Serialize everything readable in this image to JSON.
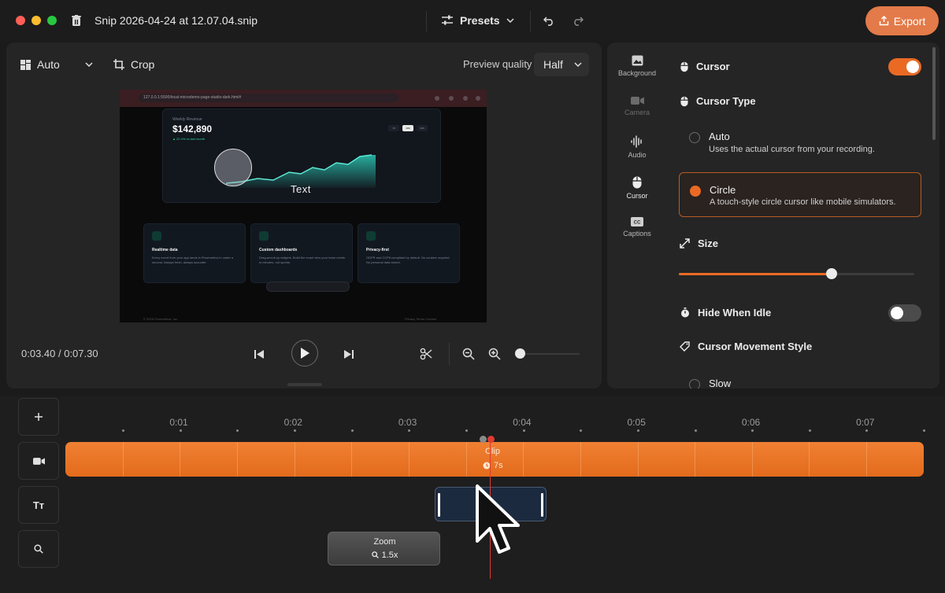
{
  "window": {
    "title": "Snip 2026-04-24 at 12.07.04.snip",
    "presets_label": "Presets",
    "export_label": "Export"
  },
  "preview": {
    "layout_label": "Auto",
    "crop_label": "Crop",
    "quality_label": "Preview quality",
    "quality_value": "Half",
    "timecode": "0:03.40 / 0:07.30",
    "zoom_level": 0.05,
    "video": {
      "url": "127.0.0.1:5500/local-microdemo-page-studio-dark.html#",
      "hero_caption": "Weekly Revenue",
      "hero_value": "$142,890",
      "hero_change": "▲ 22.4% vs last month",
      "pills": [
        "7D",
        "30D",
        "90D"
      ],
      "overlay_text": "Text",
      "features": [
        {
          "title": "Realtime data",
          "desc": "Every event from your app lands in Flowmetrics in under a second. Always fresh, always accurate."
        },
        {
          "title": "Custom dashboards",
          "desc": "Drag-and-drop widgets. Build the exact view your team needs in minutes, not sprints."
        },
        {
          "title": "Privacy-first",
          "desc": "GDPR and CCPA compliant by default. No cookies required. No personal data stored."
        }
      ],
      "footer_left": "© 2026 Flowmetrics, Inc.",
      "footer_right": "Privacy   Terms   Contact"
    }
  },
  "inspector": {
    "tabs": [
      {
        "label": "Background",
        "icon": "image-icon"
      },
      {
        "label": "Camera",
        "icon": "camera-icon"
      },
      {
        "label": "Audio",
        "icon": "waveform-icon"
      },
      {
        "label": "Cursor",
        "icon": "mouse-icon"
      },
      {
        "label": "Captions",
        "icon": "captions-icon"
      }
    ],
    "cursor_label": "Cursor",
    "cursor_enabled": true,
    "cursor_type_label": "Cursor Type",
    "options": [
      {
        "title": "Auto",
        "desc": "Uses the actual cursor from your recording."
      },
      {
        "title": "Circle",
        "desc": "A touch-style circle cursor like mobile simulators."
      }
    ],
    "selected_option": "Circle",
    "size_label": "Size",
    "size_value": 0.65,
    "hide_idle_label": "Hide When Idle",
    "hide_idle_enabled": false,
    "movement_label": "Cursor Movement Style",
    "movement_first_option": "Slow"
  },
  "timeline": {
    "ruler": [
      "0:01",
      "0:02",
      "0:03",
      "0:04",
      "0:05",
      "0:06",
      "0:07"
    ],
    "clip_label": "Clip",
    "clip_duration": "7s",
    "zoom_label": "Zoom",
    "zoom_value": "1.5x",
    "text_button_label": "Tт"
  },
  "colors": {
    "accent": "#ea6a24",
    "export": "#e37a49",
    "playhead": "#e03b2f"
  }
}
